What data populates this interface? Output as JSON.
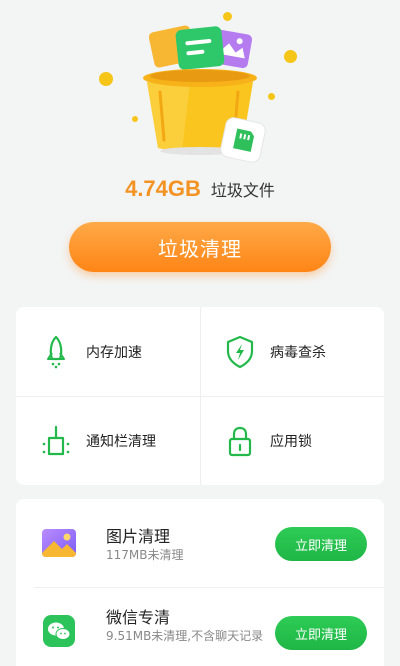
{
  "summary": {
    "size": "4.74GB",
    "label": "垃圾文件"
  },
  "main_button": {
    "label": "垃圾清理"
  },
  "tools": [
    {
      "label": "内存加速",
      "icon": "rocket-icon"
    },
    {
      "label": "病毒查杀",
      "icon": "shield-icon"
    },
    {
      "label": "通知栏清理",
      "icon": "broom-icon"
    },
    {
      "label": "应用锁",
      "icon": "lock-icon"
    }
  ],
  "items": [
    {
      "title": "图片清理",
      "subtitle": "117MB未清理",
      "button": "立即清理",
      "icon": "gallery-icon"
    },
    {
      "title": "微信专清",
      "subtitle": "9.51MB未清理,不含聊天记录",
      "button": "立即清理",
      "icon": "wechat-icon"
    }
  ],
  "colors": {
    "accent_orange": "#ff8c1e",
    "accent_green": "#22b94a",
    "size_text": "#f39323"
  }
}
